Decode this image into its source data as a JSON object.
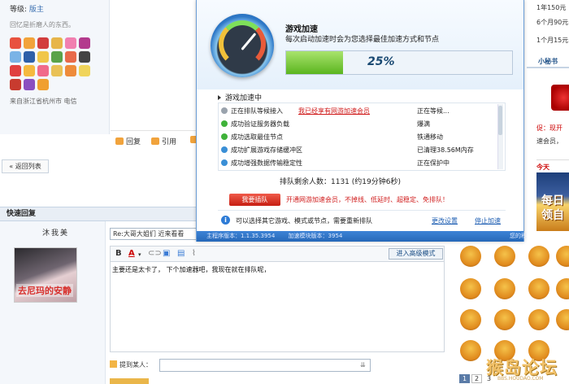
{
  "user_panel": {
    "rank_label": "等级:",
    "rank_value": "版主",
    "motto": "回忆是折磨人的东西。",
    "location": "来自浙江省杭州市 电信"
  },
  "post_actions": {
    "reply": "回复",
    "quote": "引用"
  },
  "back_button": "« 返回列表",
  "quick_reply": {
    "header": "快速回复",
    "username": "沐我美",
    "avatar_caption": "去尼玛的安静",
    "subject_value": "Re:大哥大姐们 近来看看",
    "advanced_mode": "进入高级模式",
    "editor_text": "主要还是太卡了，  下个加速器吧，我现在就在排队呢，",
    "mention_label": "提到某人：",
    "mention_dropdown": "⇊"
  },
  "emoji_pager": [
    "1",
    "2",
    "3"
  ],
  "watermark": {
    "text": "猴岛论坛",
    "sub": "BBS.HOUDAO.COM"
  },
  "right_column": {
    "line1": "1年150元",
    "line2": "6个月90元",
    "line3": "1个月15元",
    "mishu": "小秘书",
    "promo_line1": "促：现开",
    "promo_line2": "速会员，",
    "today": "今天",
    "banner": "每日\n领自"
  },
  "popup": {
    "title": "游戏加速",
    "description": "每次启动加速时会为您选择最佳加速方式和节点",
    "progress_percent": 25,
    "progress_label": "25%",
    "status_title": "游戏加速中",
    "steps": [
      {
        "label": "正在排队等候接入",
        "status": "正在等候...",
        "color": "#9aa3ad"
      },
      {
        "label": "成功验证服务器负载",
        "status": "爆满",
        "color": "#3fb23a"
      },
      {
        "label": "成功选取最佳节点",
        "status": "铁通移动",
        "color": "#3fb23a"
      },
      {
        "label": "成功扩展游戏存储缓冲区",
        "status": "已清理38.56M内存",
        "color": "#3a8fd6"
      },
      {
        "label": "成功增强数据传输稳定性",
        "status": "正在保护中",
        "color": "#3a8fd6"
      }
    ],
    "vip_link": "我已经享有网游加速会员",
    "queue_text": "排队剩余人数：1131 (约19分钟6秒)",
    "queue_button": "我要插队",
    "queue_promo": "开通网游加速会员，不掉线、低延时、超稳定、免排队！",
    "info_text": "可以选择其它游戏、模式或节点，需要重新排队",
    "change_link": "更改设置",
    "stop_link": "停止加速",
    "footer_main": "主程序版本：1.1.35.3954",
    "footer_module": "加速模块版本：3954",
    "footer_right": "您的积"
  },
  "colors": {
    "accent_blue": "#2d7bd6",
    "alert_red": "#d01c1c",
    "progress_green": "#5bb51f"
  }
}
